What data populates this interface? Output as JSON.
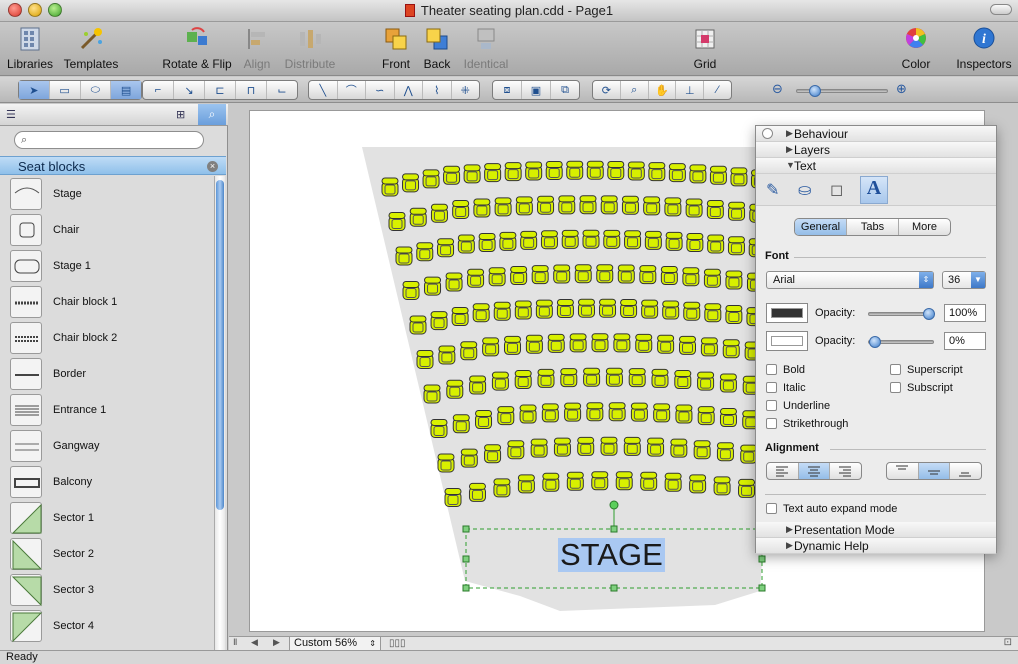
{
  "window": {
    "title": "Theater seating plan.cdd - Page1"
  },
  "toolbar": {
    "libraries": "Libraries",
    "templates": "Templates",
    "rotate_flip": "Rotate & Flip",
    "align": "Align",
    "distribute": "Distribute",
    "front": "Front",
    "back": "Back",
    "identical": "Identical",
    "grid": "Grid",
    "color": "Color",
    "inspectors": "Inspectors"
  },
  "library": {
    "title": "Seat blocks",
    "search_placeholder": "",
    "items": [
      {
        "label": "Stage",
        "icon": "stage-icon"
      },
      {
        "label": "Chair",
        "icon": "chair-icon"
      },
      {
        "label": "Stage 1",
        "icon": "stage-1-icon"
      },
      {
        "label": "Chair block 1",
        "icon": "chair-block-1-icon"
      },
      {
        "label": "Chair block 2",
        "icon": "chair-block-2-icon"
      },
      {
        "label": "Border",
        "icon": "border-icon"
      },
      {
        "label": "Entrance 1",
        "icon": "entrance-icon"
      },
      {
        "label": "Gangway",
        "icon": "gangway-icon"
      },
      {
        "label": "Balcony",
        "icon": "balcony-icon"
      },
      {
        "label": "Sector 1",
        "icon": "sector-1-icon"
      },
      {
        "label": "Sector 2",
        "icon": "sector-2-icon"
      },
      {
        "label": "Sector 3",
        "icon": "sector-3-icon"
      },
      {
        "label": "Sector 4",
        "icon": "sector-4-icon"
      }
    ]
  },
  "canvas": {
    "stage_label": "STAGE",
    "seat_color": "#d8f000",
    "floor_color": "#e2e2e2",
    "rows": [
      {
        "seats": 20
      },
      {
        "seats": 19
      },
      {
        "seats": 19
      },
      {
        "seats": 18
      },
      {
        "seats": 18
      },
      {
        "seats": 17
      },
      {
        "seats": 16
      },
      {
        "seats": 16
      },
      {
        "seats": 15
      },
      {
        "seats": 14
      }
    ]
  },
  "inspector": {
    "behaviour": "Behaviour",
    "layers": "Layers",
    "text": "Text",
    "tabs": [
      "General",
      "Tabs",
      "More"
    ],
    "active_tab": "General",
    "font_section": "Font",
    "font_name": "Arial",
    "font_size": "36",
    "opacity_label": "Opacity:",
    "text_opacity": "100%",
    "fill_opacity": "0%",
    "checkboxes": {
      "bold": "Bold",
      "italic": "Italic",
      "underline": "Underline",
      "strikethrough": "Strikethrough",
      "superscript": "Superscript",
      "subscript": "Subscript"
    },
    "alignment_section": "Alignment",
    "auto_expand": "Text auto expand mode",
    "presentation_mode": "Presentation Mode",
    "dynamic_help": "Dynamic Help"
  },
  "status": {
    "zoom": "Custom 56%",
    "text": "Ready"
  }
}
